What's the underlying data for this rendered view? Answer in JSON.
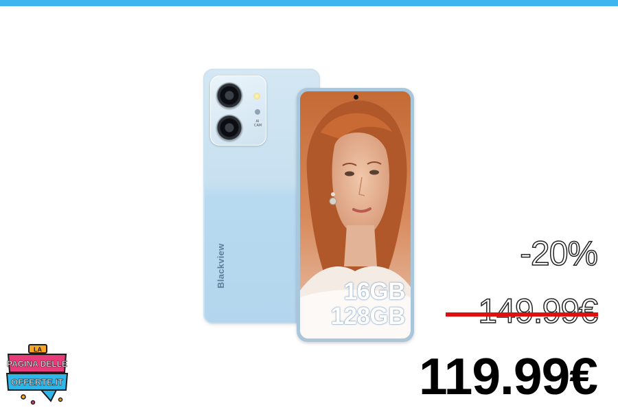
{
  "colors": {
    "top_bar": "#3fb5f0",
    "strike": "#e01010"
  },
  "product": {
    "brand": "Blackview",
    "ram": "16GB",
    "storage": "128GB",
    "camera_badge_line1": "AI",
    "camera_badge_line2": "CAM"
  },
  "pricing": {
    "discount": "-20%",
    "old_price": "149.99€",
    "new_price": "119.99€"
  },
  "logo": {
    "line1": "LA",
    "line2": "PAGINA DELLE",
    "line3": "OFFERTE.IT"
  }
}
